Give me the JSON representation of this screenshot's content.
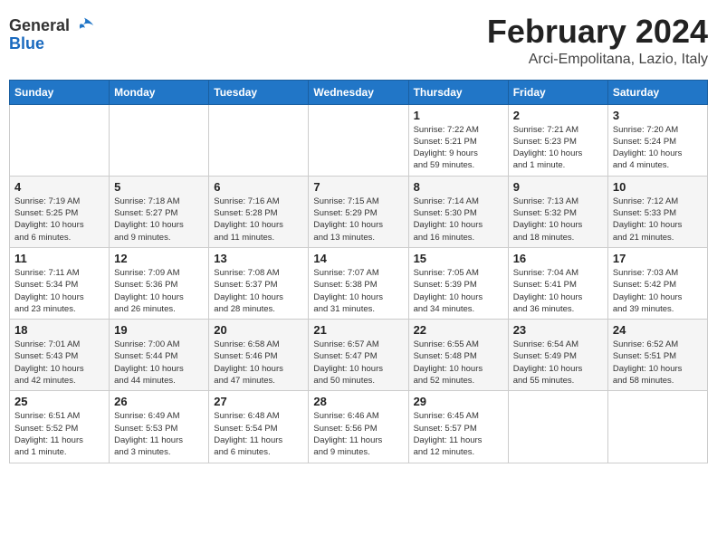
{
  "header": {
    "logo_general": "General",
    "logo_blue": "Blue",
    "month_title": "February 2024",
    "location": "Arci-Empolitana, Lazio, Italy"
  },
  "days_of_week": [
    "Sunday",
    "Monday",
    "Tuesday",
    "Wednesday",
    "Thursday",
    "Friday",
    "Saturday"
  ],
  "weeks": [
    {
      "row": 1,
      "days": [
        {
          "date": "",
          "info": ""
        },
        {
          "date": "",
          "info": ""
        },
        {
          "date": "",
          "info": ""
        },
        {
          "date": "",
          "info": ""
        },
        {
          "date": "1",
          "info": "Sunrise: 7:22 AM\nSunset: 5:21 PM\nDaylight: 9 hours\nand 59 minutes."
        },
        {
          "date": "2",
          "info": "Sunrise: 7:21 AM\nSunset: 5:23 PM\nDaylight: 10 hours\nand 1 minute."
        },
        {
          "date": "3",
          "info": "Sunrise: 7:20 AM\nSunset: 5:24 PM\nDaylight: 10 hours\nand 4 minutes."
        }
      ]
    },
    {
      "row": 2,
      "days": [
        {
          "date": "4",
          "info": "Sunrise: 7:19 AM\nSunset: 5:25 PM\nDaylight: 10 hours\nand 6 minutes."
        },
        {
          "date": "5",
          "info": "Sunrise: 7:18 AM\nSunset: 5:27 PM\nDaylight: 10 hours\nand 9 minutes."
        },
        {
          "date": "6",
          "info": "Sunrise: 7:16 AM\nSunset: 5:28 PM\nDaylight: 10 hours\nand 11 minutes."
        },
        {
          "date": "7",
          "info": "Sunrise: 7:15 AM\nSunset: 5:29 PM\nDaylight: 10 hours\nand 13 minutes."
        },
        {
          "date": "8",
          "info": "Sunrise: 7:14 AM\nSunset: 5:30 PM\nDaylight: 10 hours\nand 16 minutes."
        },
        {
          "date": "9",
          "info": "Sunrise: 7:13 AM\nSunset: 5:32 PM\nDaylight: 10 hours\nand 18 minutes."
        },
        {
          "date": "10",
          "info": "Sunrise: 7:12 AM\nSunset: 5:33 PM\nDaylight: 10 hours\nand 21 minutes."
        }
      ]
    },
    {
      "row": 3,
      "days": [
        {
          "date": "11",
          "info": "Sunrise: 7:11 AM\nSunset: 5:34 PM\nDaylight: 10 hours\nand 23 minutes."
        },
        {
          "date": "12",
          "info": "Sunrise: 7:09 AM\nSunset: 5:36 PM\nDaylight: 10 hours\nand 26 minutes."
        },
        {
          "date": "13",
          "info": "Sunrise: 7:08 AM\nSunset: 5:37 PM\nDaylight: 10 hours\nand 28 minutes."
        },
        {
          "date": "14",
          "info": "Sunrise: 7:07 AM\nSunset: 5:38 PM\nDaylight: 10 hours\nand 31 minutes."
        },
        {
          "date": "15",
          "info": "Sunrise: 7:05 AM\nSunset: 5:39 PM\nDaylight: 10 hours\nand 34 minutes."
        },
        {
          "date": "16",
          "info": "Sunrise: 7:04 AM\nSunset: 5:41 PM\nDaylight: 10 hours\nand 36 minutes."
        },
        {
          "date": "17",
          "info": "Sunrise: 7:03 AM\nSunset: 5:42 PM\nDaylight: 10 hours\nand 39 minutes."
        }
      ]
    },
    {
      "row": 4,
      "days": [
        {
          "date": "18",
          "info": "Sunrise: 7:01 AM\nSunset: 5:43 PM\nDaylight: 10 hours\nand 42 minutes."
        },
        {
          "date": "19",
          "info": "Sunrise: 7:00 AM\nSunset: 5:44 PM\nDaylight: 10 hours\nand 44 minutes."
        },
        {
          "date": "20",
          "info": "Sunrise: 6:58 AM\nSunset: 5:46 PM\nDaylight: 10 hours\nand 47 minutes."
        },
        {
          "date": "21",
          "info": "Sunrise: 6:57 AM\nSunset: 5:47 PM\nDaylight: 10 hours\nand 50 minutes."
        },
        {
          "date": "22",
          "info": "Sunrise: 6:55 AM\nSunset: 5:48 PM\nDaylight: 10 hours\nand 52 minutes."
        },
        {
          "date": "23",
          "info": "Sunrise: 6:54 AM\nSunset: 5:49 PM\nDaylight: 10 hours\nand 55 minutes."
        },
        {
          "date": "24",
          "info": "Sunrise: 6:52 AM\nSunset: 5:51 PM\nDaylight: 10 hours\nand 58 minutes."
        }
      ]
    },
    {
      "row": 5,
      "days": [
        {
          "date": "25",
          "info": "Sunrise: 6:51 AM\nSunset: 5:52 PM\nDaylight: 11 hours\nand 1 minute."
        },
        {
          "date": "26",
          "info": "Sunrise: 6:49 AM\nSunset: 5:53 PM\nDaylight: 11 hours\nand 3 minutes."
        },
        {
          "date": "27",
          "info": "Sunrise: 6:48 AM\nSunset: 5:54 PM\nDaylight: 11 hours\nand 6 minutes."
        },
        {
          "date": "28",
          "info": "Sunrise: 6:46 AM\nSunset: 5:56 PM\nDaylight: 11 hours\nand 9 minutes."
        },
        {
          "date": "29",
          "info": "Sunrise: 6:45 AM\nSunset: 5:57 PM\nDaylight: 11 hours\nand 12 minutes."
        },
        {
          "date": "",
          "info": ""
        },
        {
          "date": "",
          "info": ""
        }
      ]
    }
  ]
}
